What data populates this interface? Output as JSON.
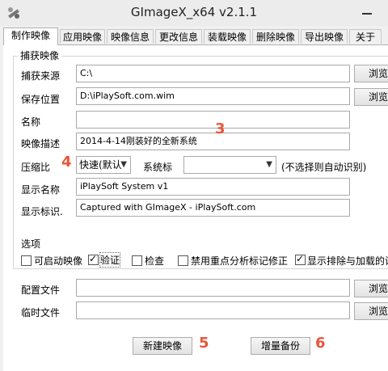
{
  "window": {
    "title": "GImageX_x64 v2.1.1",
    "app_icon": "tools-icon"
  },
  "tabs": [
    {
      "label": "制作映像",
      "active": true
    },
    {
      "label": "应用映像"
    },
    {
      "label": "映像信息"
    },
    {
      "label": "更改信息"
    },
    {
      "label": "装载映像"
    },
    {
      "label": "删除映像"
    },
    {
      "label": "导出映像"
    },
    {
      "label": "关于"
    }
  ],
  "capture": {
    "group_title": "捕获映像",
    "source_label": "捕获来源",
    "source_value": "C:\\",
    "save_label": "保存位置",
    "save_value": "D:\\iPlaySoft.com.wim",
    "browse_label": "浏览",
    "name_label": "名称",
    "name_value": "",
    "desc_label": "映像描述",
    "desc_value": "2014-4-14刚装好的全新系统",
    "compress_label": "压缩比",
    "compress_value": "快速(默认",
    "system_label": "系统标",
    "system_value": "",
    "system_hint": "(不选择则自动识别)",
    "display_name_label": "显示名称",
    "display_name_value": "iPlaySoft System v1",
    "display_tag_label": "显示标识.",
    "display_tag_value": "Captured with GImageX - iPlaySoft.com"
  },
  "options": {
    "group_title": "选项",
    "bootable": "可启动映像",
    "verify": "验证",
    "check": "检查",
    "disable_reparse": "禁用重点分析标记修正",
    "show_exclusions": "显示排除与加载的设",
    "config_label": "配置文件",
    "config_value": "",
    "temp_label": "临时文件",
    "temp_value": ""
  },
  "actions": {
    "new_image": "新建映像",
    "incremental": "增量备份"
  },
  "annotations": {
    "n3": "3",
    "n4": "4",
    "n5": "5",
    "n6": "6"
  },
  "colors": {
    "annotation": "#e8563a"
  }
}
